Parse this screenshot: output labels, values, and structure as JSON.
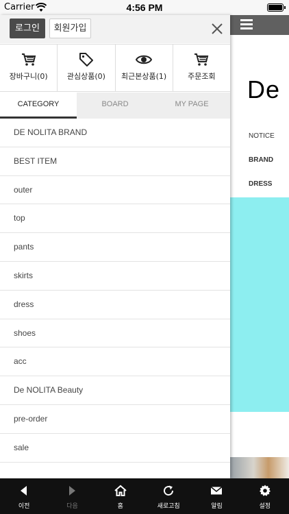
{
  "status_bar": {
    "carrier": "Carrier",
    "time": "4:56 PM"
  },
  "drawer": {
    "login_label": "로그인",
    "join_label": "회원가입",
    "quick_links": [
      {
        "label": "장바구니(0)",
        "icon": "cart-icon"
      },
      {
        "label": "관심상품(0)",
        "icon": "tag-icon"
      },
      {
        "label": "최근본상품(1)",
        "icon": "eye-icon"
      },
      {
        "label": "주문조회",
        "icon": "cart-icon"
      }
    ],
    "tabs": [
      "CATEGORY",
      "BOARD",
      "MY PAGE"
    ],
    "active_tab": "CATEGORY",
    "categories": [
      "DE NOLITA BRAND",
      "BEST ITEM",
      "outer",
      "top",
      "pants",
      "skirts",
      "dress",
      "shoes",
      "acc",
      "De NOLITA Beauty",
      "pre-order",
      "sale"
    ]
  },
  "background_page": {
    "logo": "De N",
    "nav": [
      "NOTICE",
      "BRAND",
      "DRESS"
    ],
    "banner_color": "#8deef0"
  },
  "bottom_bar": {
    "items": [
      {
        "label": "이전",
        "icon": "back-arrow-icon",
        "enabled": true
      },
      {
        "label": "다음",
        "icon": "forward-arrow-icon",
        "enabled": false
      },
      {
        "label": "홈",
        "icon": "home-icon",
        "enabled": true
      },
      {
        "label": "새로고침",
        "icon": "refresh-icon",
        "enabled": true
      },
      {
        "label": "알림",
        "icon": "mail-icon",
        "enabled": true
      },
      {
        "label": "설정",
        "icon": "gear-icon",
        "enabled": true
      }
    ]
  }
}
